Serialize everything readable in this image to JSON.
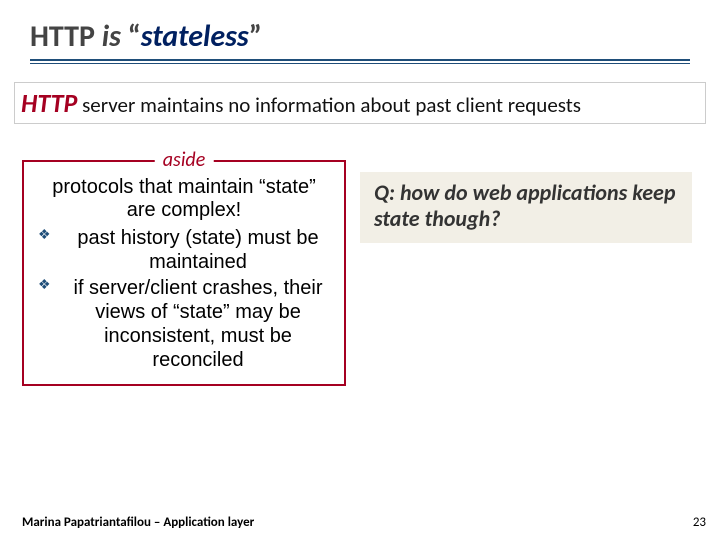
{
  "title": {
    "prefix": "HTTP ",
    "is_word": "is ",
    "qopen": "“",
    "stateless": "stateless",
    "qclose": "”"
  },
  "subtitle": {
    "http": "HTTP",
    "rest": " server maintains no information about past client requests"
  },
  "aside": {
    "legend": "aside",
    "line1": "protocols that maintain “state” are complex!",
    "bullets": [
      "past history (state) must be maintained",
      "if server/client crashes, their views of “state” may be inconsistent, must be reconciled"
    ]
  },
  "question": "Q: how do web applications keep state though?",
  "footer": "Marina Papatriantafilou –  Application layer",
  "page_number": "23"
}
